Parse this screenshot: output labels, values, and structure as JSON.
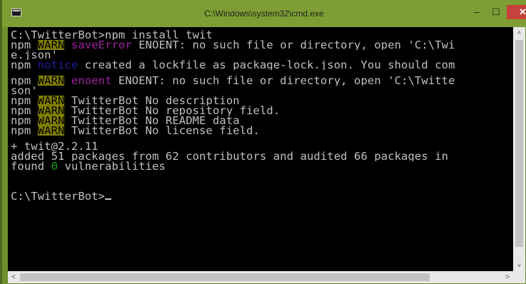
{
  "window": {
    "title": "C:\\Windows\\system32\\cmd.exe",
    "controls": {
      "minimize": "–",
      "maximize": "☐",
      "close": "✕"
    },
    "icon": "console-icon"
  },
  "console": {
    "lines": [
      [
        {
          "text": "C:\\TwitterBot>npm install twit",
          "style": ""
        }
      ],
      [
        {
          "text": "npm ",
          "style": ""
        },
        {
          "text": "WARN",
          "style": "warn"
        },
        {
          "text": " ",
          "style": ""
        },
        {
          "text": "saveError",
          "style": "magenta"
        },
        {
          "text": " ENOENT: no such file or directory, open 'C:\\Twi",
          "style": ""
        }
      ],
      [
        {
          "text": "e.json'",
          "style": ""
        }
      ],
      [
        {
          "text": "npm ",
          "style": ""
        },
        {
          "text": "notice",
          "style": "notice"
        },
        {
          "text": " created a lockfile as package-lock.json. You should com",
          "style": ""
        }
      ],
      "gap",
      [
        {
          "text": "npm ",
          "style": ""
        },
        {
          "text": "WARN",
          "style": "warn"
        },
        {
          "text": " ",
          "style": ""
        },
        {
          "text": "enoent",
          "style": "magenta"
        },
        {
          "text": " ENOENT: no such file or directory, open 'C:\\Twitte",
          "style": ""
        }
      ],
      [
        {
          "text": "son'",
          "style": ""
        }
      ],
      [
        {
          "text": "npm ",
          "style": ""
        },
        {
          "text": "WARN",
          "style": "warn"
        },
        {
          "text": " TwitterBot No description",
          "style": ""
        }
      ],
      [
        {
          "text": "npm ",
          "style": ""
        },
        {
          "text": "WARN",
          "style": "warn"
        },
        {
          "text": " TwitterBot No repository field.",
          "style": ""
        }
      ],
      [
        {
          "text": "npm ",
          "style": ""
        },
        {
          "text": "WARN",
          "style": "warn"
        },
        {
          "text": " TwitterBot No README data",
          "style": ""
        }
      ],
      [
        {
          "text": "npm ",
          "style": ""
        },
        {
          "text": "WARN",
          "style": "warn"
        },
        {
          "text": " TwitterBot No license field.",
          "style": ""
        }
      ],
      "gap",
      [
        {
          "text": "+ twit@2.2.11",
          "style": ""
        }
      ],
      [
        {
          "text": "added 51 packages from 62 contributors and audited 66 packages in",
          "style": ""
        }
      ],
      [
        {
          "text": "found ",
          "style": ""
        },
        {
          "text": "0",
          "style": "green"
        },
        {
          "text": " vulnerabilities",
          "style": ""
        }
      ],
      "blank",
      "blank",
      [
        {
          "text": "C:\\TwitterBot>",
          "style": ""
        },
        {
          "text": "",
          "style": "cursor"
        }
      ]
    ]
  },
  "scrollbars": {
    "vertical": {
      "up": "˄",
      "down": "˅"
    },
    "horizontal": {
      "left": "<",
      "right": ">"
    }
  },
  "colors": {
    "desktop": "#5c7a2a",
    "titlebar": "#7d9e34",
    "console_bg": "#000000",
    "console_fg": "#c0c0c0",
    "warn_bg": "#808000",
    "magenta": "#a0229e",
    "notice": "#1d1d9e",
    "green": "#13a10e",
    "close": "#c7413c"
  }
}
